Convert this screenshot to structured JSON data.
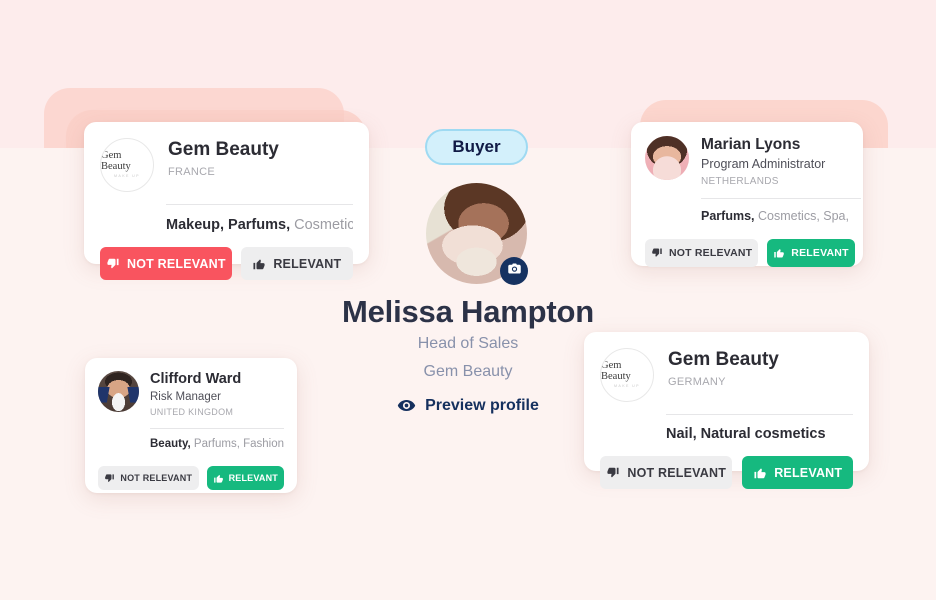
{
  "hero": {
    "badge_label": "Buyer",
    "name": "Melissa Hampton",
    "role": "Head of Sales",
    "company": "Gem Beauty",
    "preview_label": "Preview profile",
    "camera_icon": "camera-icon",
    "eye_icon": "eye-icon",
    "badge_bg": "#d3f0fb",
    "badge_border": "#9fdaf2",
    "badge_text_color": "#101a45"
  },
  "colors": {
    "page_bg": "#fdecec",
    "center_bg": "#fdf3f1",
    "not_relevant_red": "#f9545f",
    "relevant_green": "#16b97f",
    "neutral_grey": "#eeeeef",
    "deco_pink": "#fbd2c9"
  },
  "buttons": {
    "not_relevant": "NOT RELEVANT",
    "relevant": "RELEVANT",
    "thumb_down_icon": "thumbs-down-icon",
    "thumb_up_icon": "thumbs-up-icon"
  },
  "cards": [
    {
      "id": "gem-beauty-france",
      "avatar_type": "logo",
      "logo_main": "Gem Beauty",
      "logo_sub": "MAKE UP",
      "name": "Gem Beauty",
      "role": "",
      "country": "FRANCE",
      "tags_bold": "Makeup, Parfums,",
      "tags_rest": " Cosmetics",
      "not_relevant_style": "red",
      "relevant_style": "grey"
    },
    {
      "id": "marian-lyons",
      "avatar_type": "photo-woman",
      "logo_main": "",
      "logo_sub": "",
      "name": "Marian Lyons",
      "role": "Program Administrator",
      "country": "NETHERLANDS",
      "tags_bold": "Parfums,",
      "tags_rest": " Cosmetics, Spa,",
      "not_relevant_style": "grey",
      "relevant_style": "green"
    },
    {
      "id": "clifford-ward",
      "avatar_type": "photo-man",
      "logo_main": "",
      "logo_sub": "",
      "name": "Clifford Ward",
      "role": "Risk Manager",
      "country": "UNITED KINGDOM",
      "tags_bold": "Beauty,",
      "tags_rest": " Parfums, Fashion",
      "not_relevant_style": "grey",
      "relevant_style": "green"
    },
    {
      "id": "gem-beauty-germany",
      "avatar_type": "logo",
      "logo_main": "Gem Beauty",
      "logo_sub": "MAKE UP",
      "name": "Gem Beauty",
      "role": "",
      "country": "GERMANY",
      "tags_bold": "Nail, Natural cosmetics",
      "tags_rest": "",
      "not_relevant_style": "grey",
      "relevant_style": "green"
    }
  ]
}
